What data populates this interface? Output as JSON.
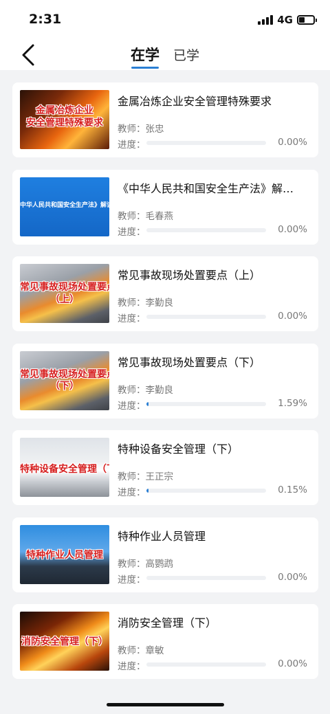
{
  "status_bar": {
    "time": "2:31",
    "network": "4G",
    "battery_level": 0.4
  },
  "nav": {
    "back_icon": "chevron-left-icon",
    "tabs": [
      {
        "label": "在学",
        "active": true
      },
      {
        "label": "已学",
        "active": false
      }
    ]
  },
  "labels": {
    "teacher_prefix": "教师：",
    "progress_prefix": "进度："
  },
  "colors": {
    "accent": "#2a7fd4",
    "thumb_caption": "#d62020"
  },
  "courses": [
    {
      "title": "金属冶炼企业安全管理特殊要求",
      "teacher": "张忠",
      "progress_text": "0.00%",
      "progress": 0.0,
      "thumb_caption": [
        "金属冶炼企业",
        "安全管理特殊要求"
      ]
    },
    {
      "title": "《中华人民共和国安全生产法》解…",
      "teacher": "毛春燕",
      "progress_text": "0.00%",
      "progress": 0.0,
      "thumb_caption": [
        "中华人民共和国安全生产法》解读（"
      ]
    },
    {
      "title": "常见事故现场处置要点（上）",
      "teacher": "李勤良",
      "progress_text": "0.00%",
      "progress": 0.0,
      "thumb_caption": [
        "常见事故现场处置要点",
        "（上）"
      ]
    },
    {
      "title": "常见事故现场处置要点（下）",
      "teacher": "李勤良",
      "progress_text": "1.59%",
      "progress": 0.0159,
      "thumb_caption": [
        "常见事故现场处置要点",
        "（下）"
      ]
    },
    {
      "title": "特种设备安全管理（下）",
      "teacher": "王正宗",
      "progress_text": "0.15%",
      "progress": 0.0015,
      "thumb_caption": [
        "特种设备安全管理（下"
      ]
    },
    {
      "title": "特种作业人员管理",
      "teacher": "高鹦鹉",
      "progress_text": "0.00%",
      "progress": 0.0,
      "thumb_caption": [
        "特种作业人员管理"
      ]
    },
    {
      "title": "消防安全管理（下）",
      "teacher": "章敏",
      "progress_text": "0.00%",
      "progress": 0.0,
      "thumb_caption": [
        "消防安全管理（下）"
      ]
    }
  ]
}
